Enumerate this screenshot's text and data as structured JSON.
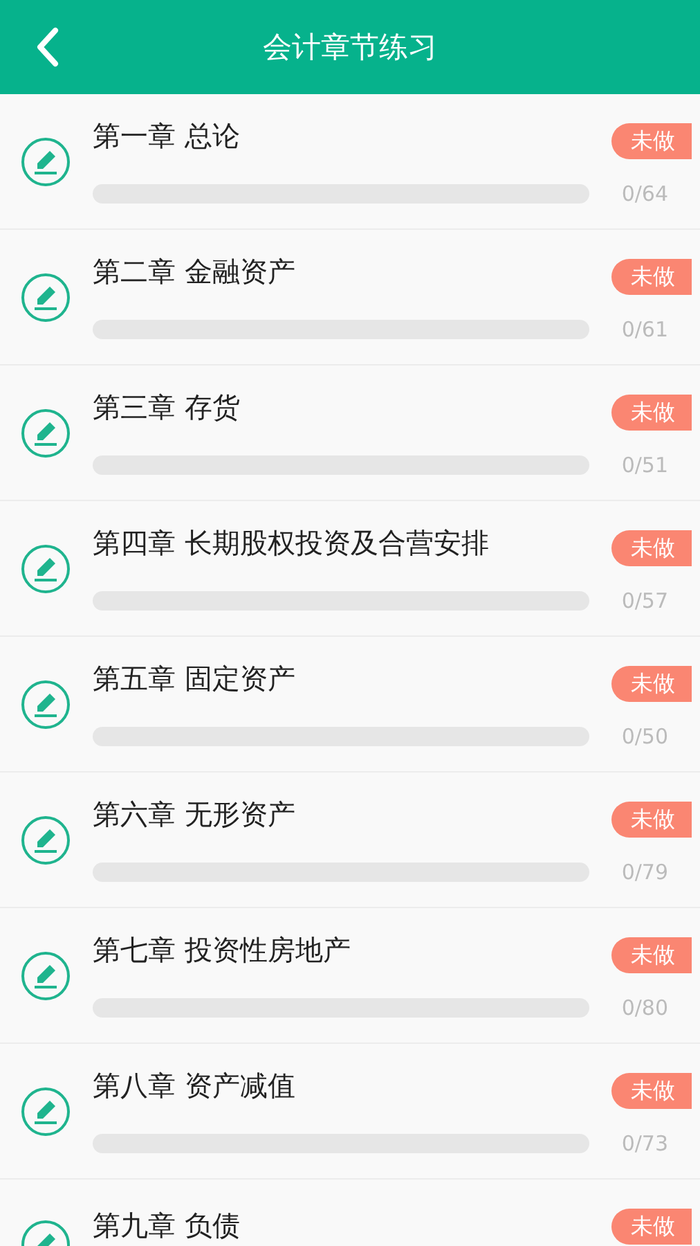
{
  "header": {
    "title": "会计章节练习"
  },
  "chapters": [
    {
      "title": "第一章 总论",
      "status": "未做",
      "count": "0/64"
    },
    {
      "title": "第二章 金融资产",
      "status": "未做",
      "count": "0/61"
    },
    {
      "title": "第三章 存货",
      "status": "未做",
      "count": "0/51"
    },
    {
      "title": "第四章 长期股权投资及合营安排",
      "status": "未做",
      "count": "0/57"
    },
    {
      "title": "第五章 固定资产",
      "status": "未做",
      "count": "0/50"
    },
    {
      "title": "第六章 无形资产",
      "status": "未做",
      "count": "0/79"
    },
    {
      "title": "第七章 投资性房地产",
      "status": "未做",
      "count": "0/80"
    },
    {
      "title": "第八章 资产减值",
      "status": "未做",
      "count": "0/73"
    },
    {
      "title": "第九章 负债",
      "status": "未做"
    }
  ]
}
